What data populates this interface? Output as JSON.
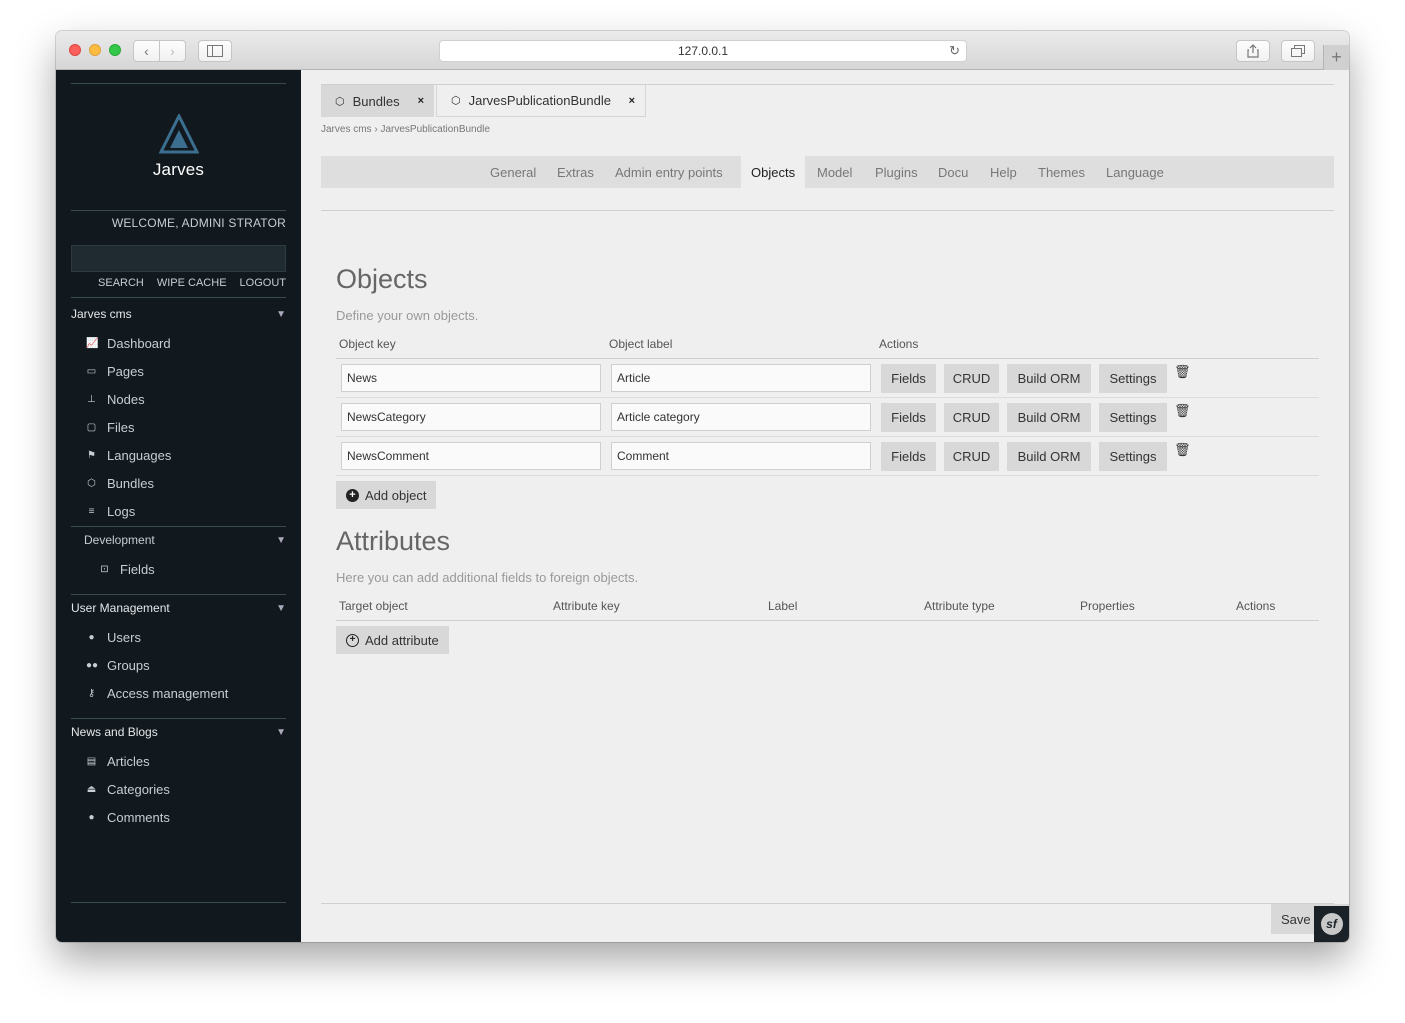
{
  "browser": {
    "url": "127.0.0.1",
    "back_icon": "‹",
    "forward_icon": "›",
    "plus_label": "+"
  },
  "sidebar": {
    "logo_text": "Jarves",
    "welcome": "WELCOME, ADMINI STRATOR",
    "links": [
      "SEARCH",
      "WIPE CACHE",
      "LOGOUT"
    ],
    "sections": [
      {
        "title": "Jarves cms",
        "items": [
          {
            "label": "Dashboard",
            "icon": "chart-icon"
          },
          {
            "label": "Pages",
            "icon": "monitor-icon"
          },
          {
            "label": "Nodes",
            "icon": "sitemap-icon"
          },
          {
            "label": "Files",
            "icon": "folder-icon"
          },
          {
            "label": "Languages",
            "icon": "flag-icon"
          },
          {
            "label": "Bundles",
            "icon": "cube-icon"
          },
          {
            "label": "Logs",
            "icon": "list-icon"
          }
        ]
      },
      {
        "title": "Development",
        "items": [
          {
            "label": "Fields",
            "icon": "field-icon"
          }
        ]
      },
      {
        "title": "User Management",
        "items": [
          {
            "label": "Users",
            "icon": "user-icon"
          },
          {
            "label": "Groups",
            "icon": "group-icon"
          },
          {
            "label": "Access management",
            "icon": "key-icon"
          }
        ]
      },
      {
        "title": "News and Blogs",
        "items": [
          {
            "label": "Articles",
            "icon": "article-icon"
          },
          {
            "label": "Categories",
            "icon": "inbox-icon"
          },
          {
            "label": "Comments",
            "icon": "comment-icon"
          }
        ]
      }
    ]
  },
  "main": {
    "tabs": [
      {
        "label": "Bundles",
        "close": "×"
      },
      {
        "label": "JarvesPublicationBundle",
        "close": "×"
      }
    ],
    "breadcrumb": "Jarves cms › JarvesPublicationBundle",
    "subtabs": [
      "General",
      "Extras",
      "Admin entry points",
      "Objects",
      "Model",
      "Plugins",
      "Docu",
      "Help",
      "Themes",
      "Language"
    ],
    "active_subtab": "Objects",
    "objects": {
      "title": "Objects",
      "description": "Define your own objects.",
      "headers": [
        "Object key",
        "Object label",
        "Actions"
      ],
      "rows": [
        {
          "key": "News",
          "label": "Article"
        },
        {
          "key": "NewsCategory",
          "label": "Article category"
        },
        {
          "key": "NewsComment",
          "label": "Comment"
        }
      ],
      "actions": [
        "Fields",
        "CRUD",
        "Build ORM",
        "Settings"
      ],
      "add_label": "Add object"
    },
    "attributes": {
      "title": "Attributes",
      "description": "Here you can add additional fields to foreign objects.",
      "headers": [
        "Target object",
        "Attribute key",
        "Label",
        "Attribute type",
        "Properties",
        "Actions"
      ],
      "add_label": "Add attribute"
    },
    "save_label": "Save",
    "symfony_badge": "sf"
  }
}
